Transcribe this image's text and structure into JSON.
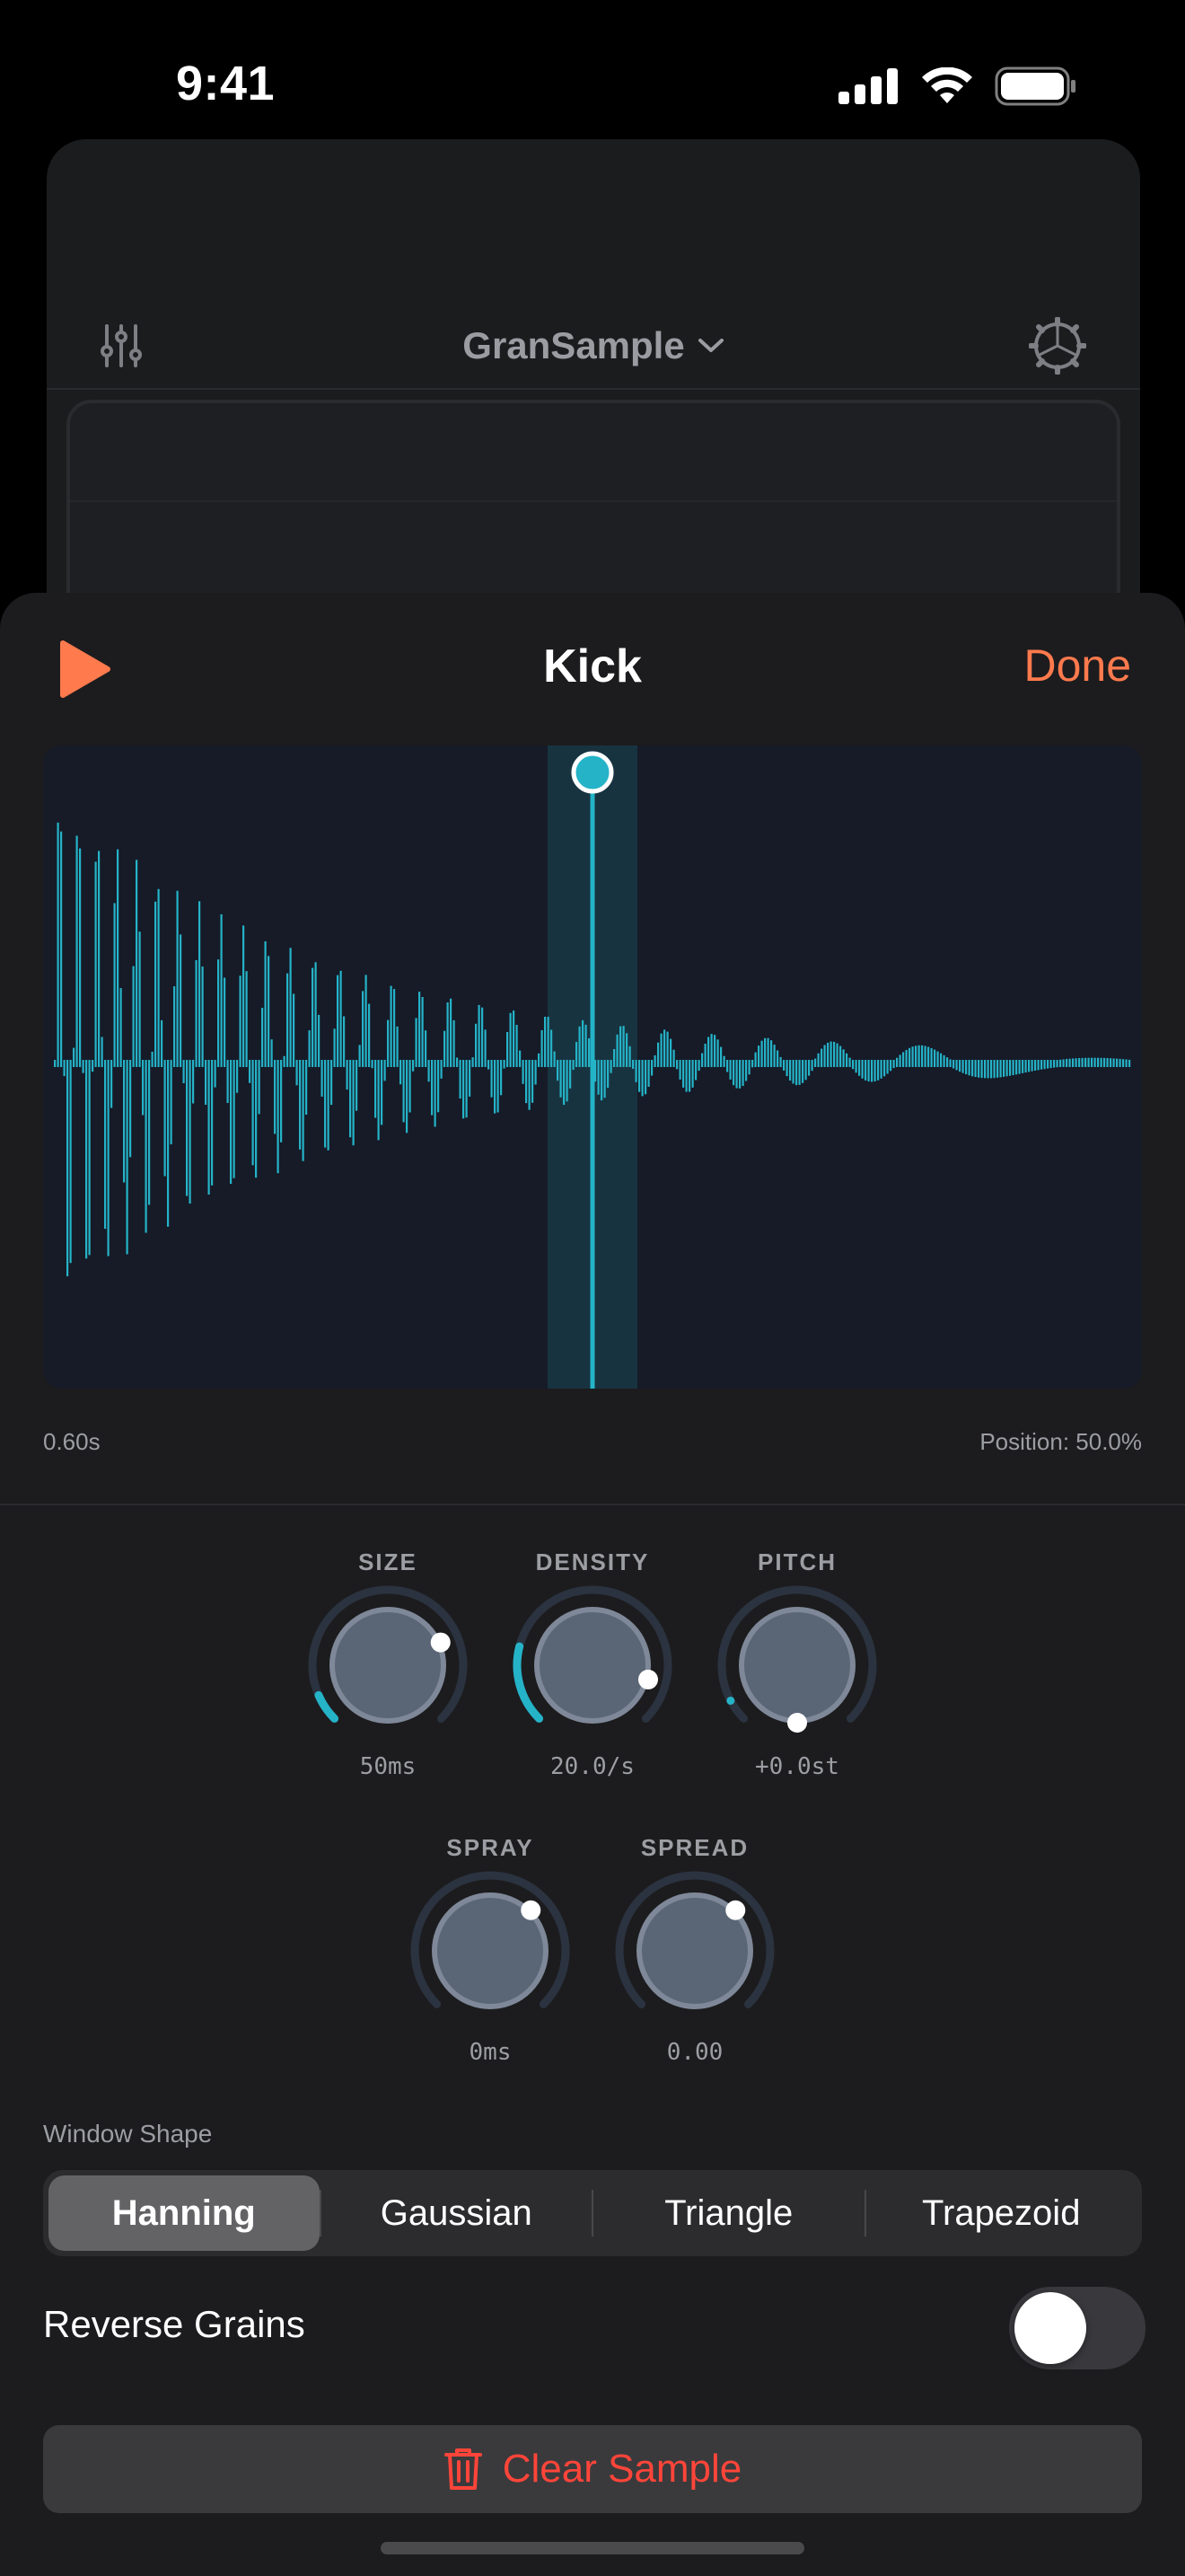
{
  "status_bar": {
    "time": "9:41"
  },
  "background": {
    "title": "GranSample"
  },
  "sheet": {
    "title": "Kick",
    "done_label": "Done"
  },
  "waveform": {
    "duration_label": "0.60s",
    "position_label": "Position: 50.0%",
    "position": 0.5
  },
  "knobs": {
    "size": {
      "label": "SIZE",
      "value": "50ms",
      "level": 0.08
    },
    "density": {
      "label": "DENSITY",
      "value": "20.0/s",
      "level": 0.22
    },
    "pitch": {
      "label": "PITCH",
      "value": "+0.0st",
      "level": 0.5
    },
    "spray": {
      "label": "SPRAY",
      "value": "0ms",
      "level": 0.0
    },
    "spread": {
      "label": "SPREAD",
      "value": "0.00",
      "level": 0.0
    }
  },
  "window_shape": {
    "label": "Window Shape",
    "options": [
      "Hanning",
      "Gaussian",
      "Triangle",
      "Trapezoid"
    ],
    "selected": "Hanning"
  },
  "reverse": {
    "label": "Reverse Grains",
    "on": false
  },
  "clear": {
    "label": "Clear Sample"
  },
  "colors": {
    "accent": "#ff7a4d",
    "wave": "#25b3c8",
    "destructive": "#ff453a"
  }
}
